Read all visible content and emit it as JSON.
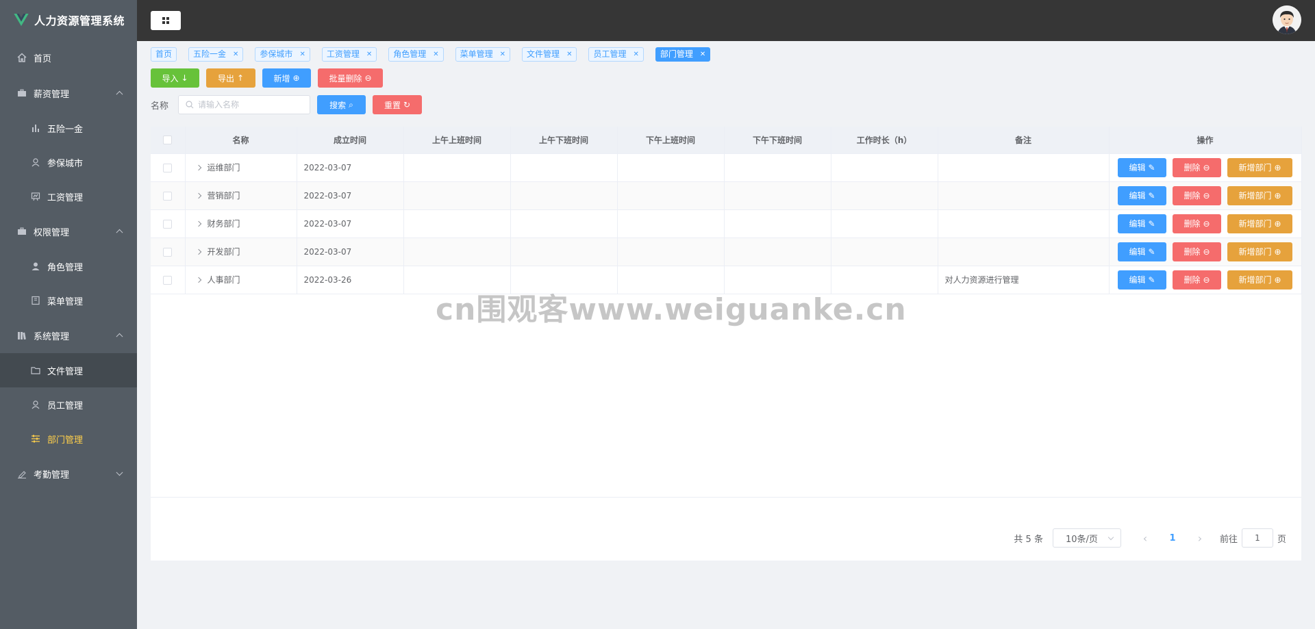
{
  "app": {
    "title": "人力资源管理系统"
  },
  "sidebar": {
    "items": [
      {
        "label": "首页",
        "icon": "home-icon"
      },
      {
        "label": "薪资管理",
        "icon": "briefcase-icon"
      },
      {
        "label": "五险一金",
        "icon": "bar-chart-icon"
      },
      {
        "label": "参保城市",
        "icon": "user-icon"
      },
      {
        "label": "工资管理",
        "icon": "presentation-icon"
      },
      {
        "label": "权限管理",
        "icon": "suitcase-icon"
      },
      {
        "label": "角色管理",
        "icon": "user-solid-icon"
      },
      {
        "label": "菜单管理",
        "icon": "notebook-icon"
      },
      {
        "label": "系统管理",
        "icon": "library-icon"
      },
      {
        "label": "文件管理",
        "icon": "folder-icon"
      },
      {
        "label": "员工管理",
        "icon": "user-icon"
      },
      {
        "label": "部门管理",
        "icon": "operation-icon"
      },
      {
        "label": "考勤管理",
        "icon": "edit-icon"
      }
    ]
  },
  "tags": [
    {
      "label": "首页"
    },
    {
      "label": "五险一金"
    },
    {
      "label": "参保城市"
    },
    {
      "label": "工资管理"
    },
    {
      "label": "角色管理"
    },
    {
      "label": "菜单管理"
    },
    {
      "label": "文件管理"
    },
    {
      "label": "员工管理"
    },
    {
      "label": "部门管理"
    }
  ],
  "toolbar": {
    "import_label": "导入",
    "export_label": "导出",
    "add_label": "新增",
    "batch_delete_label": "批量删除"
  },
  "search": {
    "label": "名称",
    "placeholder": "请输入名称",
    "search_label": "搜索",
    "reset_label": "重置"
  },
  "table": {
    "columns": [
      "名称",
      "成立时间",
      "上午上班时间",
      "上午下班时间",
      "下午上班时间",
      "下午下班时间",
      "工作时长（h）",
      "备注",
      "操作"
    ],
    "rows": [
      {
        "name": "运维部门",
        "date": "2022-03-07",
        "am_in": "",
        "am_out": "",
        "pm_in": "",
        "pm_out": "",
        "hours": "",
        "remark": ""
      },
      {
        "name": "营销部门",
        "date": "2022-03-07",
        "am_in": "",
        "am_out": "",
        "pm_in": "",
        "pm_out": "",
        "hours": "",
        "remark": ""
      },
      {
        "name": "财务部门",
        "date": "2022-03-07",
        "am_in": "",
        "am_out": "",
        "pm_in": "",
        "pm_out": "",
        "hours": "",
        "remark": ""
      },
      {
        "name": "开发部门",
        "date": "2022-03-07",
        "am_in": "",
        "am_out": "",
        "pm_in": "",
        "pm_out": "",
        "hours": "",
        "remark": ""
      },
      {
        "name": "人事部门",
        "date": "2022-03-26",
        "am_in": "",
        "am_out": "",
        "pm_in": "",
        "pm_out": "",
        "hours": "",
        "remark": "对人力资源进行管理"
      }
    ],
    "edit_label": "编辑",
    "delete_label": "删除",
    "add_dept_label": "新增部门"
  },
  "pagination": {
    "total_text": "共 5 条",
    "page_size": "10条/页",
    "current_page": "1",
    "goto_prefix": "前往",
    "goto_value": "1",
    "goto_suffix": "页"
  },
  "watermark": "cn围观客www.weiguanke.cn",
  "colors": {
    "sidebar_bg": "#545c64",
    "header_bg": "#363636",
    "active": "#ffd04b",
    "primary": "#409eff",
    "success": "#67c23a",
    "warning": "#e6a23c",
    "danger": "#f56c6c"
  }
}
